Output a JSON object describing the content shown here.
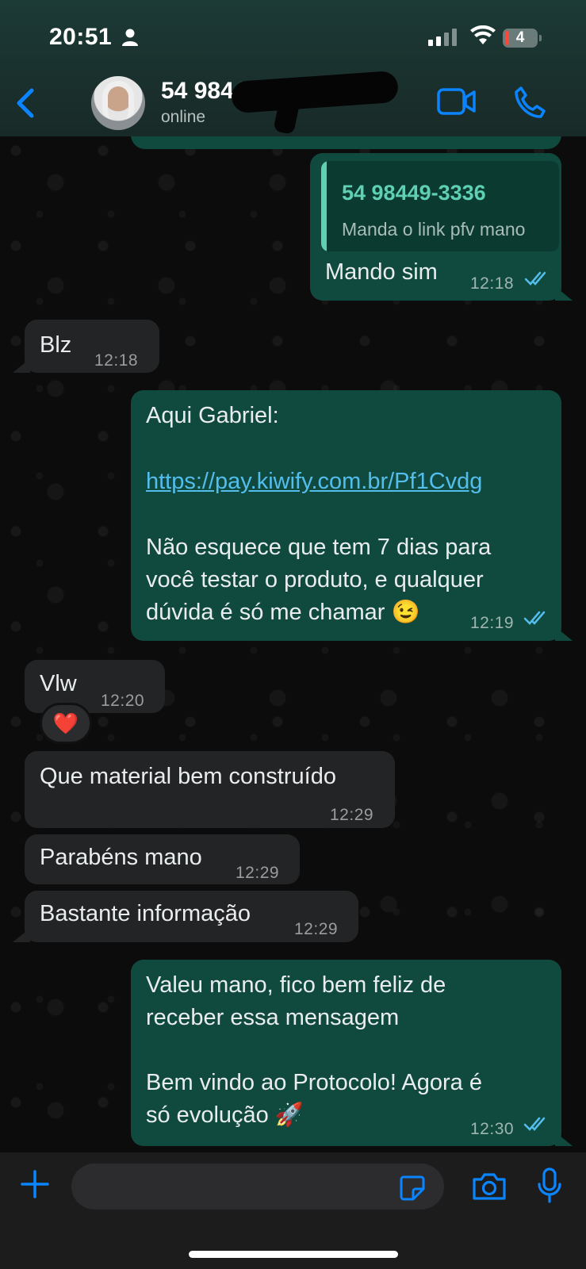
{
  "status_bar": {
    "time": "20:51",
    "battery": "4"
  },
  "header": {
    "contact_name": "54 9844",
    "contact_status": "online"
  },
  "messages": [
    {
      "id": 1,
      "direction": "out",
      "quote_name": "54 98449-3336",
      "quote_text": "Manda o link pfv mano",
      "text": "Mando sim",
      "time": "12:18"
    },
    {
      "id": 2,
      "direction": "in",
      "text": "Blz",
      "time": "12:18"
    },
    {
      "id": 3,
      "direction": "out",
      "line1": "Aqui Gabriel:",
      "link": "https://pay.kiwify.com.br/Pf1Cvdg",
      "line3": "Não esquece que tem 7 dias para",
      "line4": "você testar o produto, e qualquer",
      "line5": "dúvida é só me chamar 😉",
      "time": "12:19"
    },
    {
      "id": 4,
      "direction": "in",
      "text": "Vlw",
      "time": "12:20",
      "reaction": "❤️"
    },
    {
      "id": 5,
      "direction": "in",
      "text": "Que material bem construído",
      "time": "12:29"
    },
    {
      "id": 6,
      "direction": "in",
      "text": "Parabéns mano",
      "time": "12:29"
    },
    {
      "id": 7,
      "direction": "in",
      "text": "Bastante informação",
      "time": "12:29"
    },
    {
      "id": 8,
      "direction": "out",
      "line1": "Valeu mano, fico bem feliz de",
      "line2": "receber essa mensagem",
      "line3": "Bem vindo ao Protocolo! Agora é",
      "line4": "só evolução 🚀",
      "time": "12:30"
    }
  ],
  "composer": {
    "placeholder": ""
  },
  "colors": {
    "outgoing_bubble": "#104a3f",
    "incoming_bubble": "#222425",
    "accent_blue": "#0a84ff",
    "read_ticks": "#53bdeb",
    "link": "#53bdeb"
  },
  "icons": [
    "back-chevron-icon",
    "video-call-icon",
    "phone-icon",
    "plus-icon",
    "sticker-icon",
    "camera-icon",
    "microphone-icon"
  ]
}
